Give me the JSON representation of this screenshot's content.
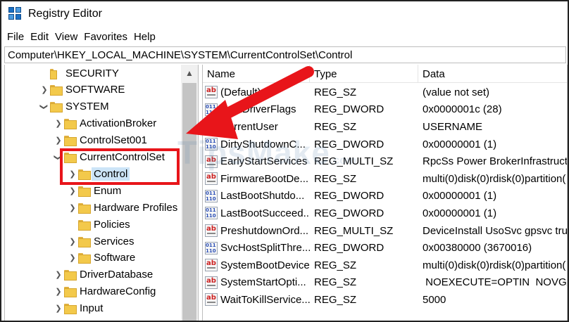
{
  "window": {
    "title": "Registry Editor"
  },
  "menu": [
    "File",
    "Edit",
    "View",
    "Favorites",
    "Help"
  ],
  "address": "Computer\\HKEY_LOCAL_MACHINE\\SYSTEM\\CurrentControlSet\\Control",
  "tree": [
    {
      "label": "SECURITY",
      "level": 1,
      "expander": "none"
    },
    {
      "label": "SOFTWARE",
      "level": 1,
      "expander": "collapsed"
    },
    {
      "label": "SYSTEM",
      "level": 1,
      "expander": "expanded"
    },
    {
      "label": "ActivationBroker",
      "level": 2,
      "expander": "collapsed"
    },
    {
      "label": "ControlSet001",
      "level": 2,
      "expander": "collapsed"
    },
    {
      "label": "CurrentControlSet",
      "level": 2,
      "expander": "expanded"
    },
    {
      "label": "Control",
      "level": 3,
      "expander": "collapsed",
      "selected": true
    },
    {
      "label": "Enum",
      "level": 3,
      "expander": "collapsed"
    },
    {
      "label": "Hardware Profiles",
      "level": 3,
      "expander": "collapsed"
    },
    {
      "label": "Policies",
      "level": 3,
      "expander": "none"
    },
    {
      "label": "Services",
      "level": 3,
      "expander": "collapsed"
    },
    {
      "label": "Software",
      "level": 3,
      "expander": "collapsed"
    },
    {
      "label": "DriverDatabase",
      "level": 2,
      "expander": "collapsed"
    },
    {
      "label": "HardwareConfig",
      "level": 2,
      "expander": "collapsed"
    },
    {
      "label": "Input",
      "level": 2,
      "expander": "collapsed"
    }
  ],
  "columns": [
    "Name",
    "Type",
    "Data"
  ],
  "values": [
    {
      "name": "(Default)",
      "type": "REG_SZ",
      "data": "(value not set)",
      "icon": "sz"
    },
    {
      "name": "BootDriverFlags",
      "type": "REG_DWORD",
      "data": "0x0000001c (28)",
      "icon": "dw"
    },
    {
      "name": "CurrentUser",
      "type": "REG_SZ",
      "data": "USERNAME",
      "icon": "sz"
    },
    {
      "name": "DirtyShutdownC...",
      "type": "REG_DWORD",
      "data": "0x00000001 (1)",
      "icon": "dw"
    },
    {
      "name": "EarlyStartServices",
      "type": "REG_MULTI_SZ",
      "data": "RpcSs Power BrokerInfrastructu",
      "icon": "sz"
    },
    {
      "name": "FirmwareBootDe...",
      "type": "REG_SZ",
      "data": "multi(0)disk(0)rdisk(0)partition(",
      "icon": "sz"
    },
    {
      "name": "LastBootShutdo...",
      "type": "REG_DWORD",
      "data": "0x00000001 (1)",
      "icon": "dw"
    },
    {
      "name": "LastBootSucceed...",
      "type": "REG_DWORD",
      "data": "0x00000001 (1)",
      "icon": "dw"
    },
    {
      "name": "PreshutdownOrd...",
      "type": "REG_MULTI_SZ",
      "data": "DeviceInstall UsoSvc gpsvc tru",
      "icon": "sz"
    },
    {
      "name": "SvcHostSplitThre...",
      "type": "REG_DWORD",
      "data": "0x00380000 (3670016)",
      "icon": "dw"
    },
    {
      "name": "SystemBootDevice",
      "type": "REG_SZ",
      "data": "multi(0)disk(0)rdisk(0)partition(",
      "icon": "sz"
    },
    {
      "name": "SystemStartOpti...",
      "type": "REG_SZ",
      "data": " NOEXECUTE=OPTIN  NOVGA",
      "icon": "sz"
    },
    {
      "name": "WaitToKillService...",
      "type": "REG_SZ",
      "data": "5000",
      "icon": "sz"
    }
  ],
  "watermark": {
    "main": "TipsMake",
    "suffix": ".com"
  },
  "annotation_color": "#e8151a"
}
